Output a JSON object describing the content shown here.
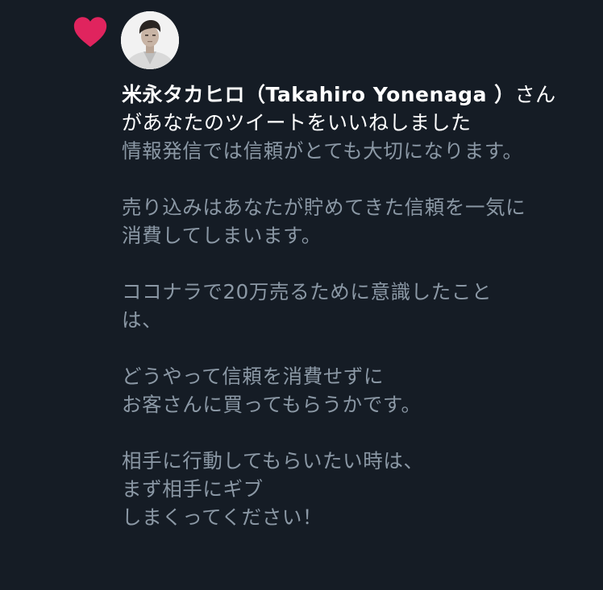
{
  "notification": {
    "type_icon": "heart-icon",
    "like_color": "#e0245e",
    "user": {
      "display_name": "米永タカヒロ（Takahiro Yonenaga ）",
      "avatar_icon": "avatar-photo"
    },
    "action_line1_suffix": "さん",
    "action_line2": "があなたのツイートをいいねしました",
    "tweet_lines": [
      "情報発信では信頼がとても大切になります。",
      "",
      "売り込みはあなたが貯めてきた信頼を一気に",
      "消費してしまいます。",
      "",
      "ココナラで20万売るために意識したこと",
      "は、",
      "",
      "どうやって信頼を消費せずに",
      "お客さんに買ってもらうかです。",
      "",
      "相手に行動してもらいたい時は、",
      "まず相手にギブ",
      "しまくってください！"
    ]
  }
}
